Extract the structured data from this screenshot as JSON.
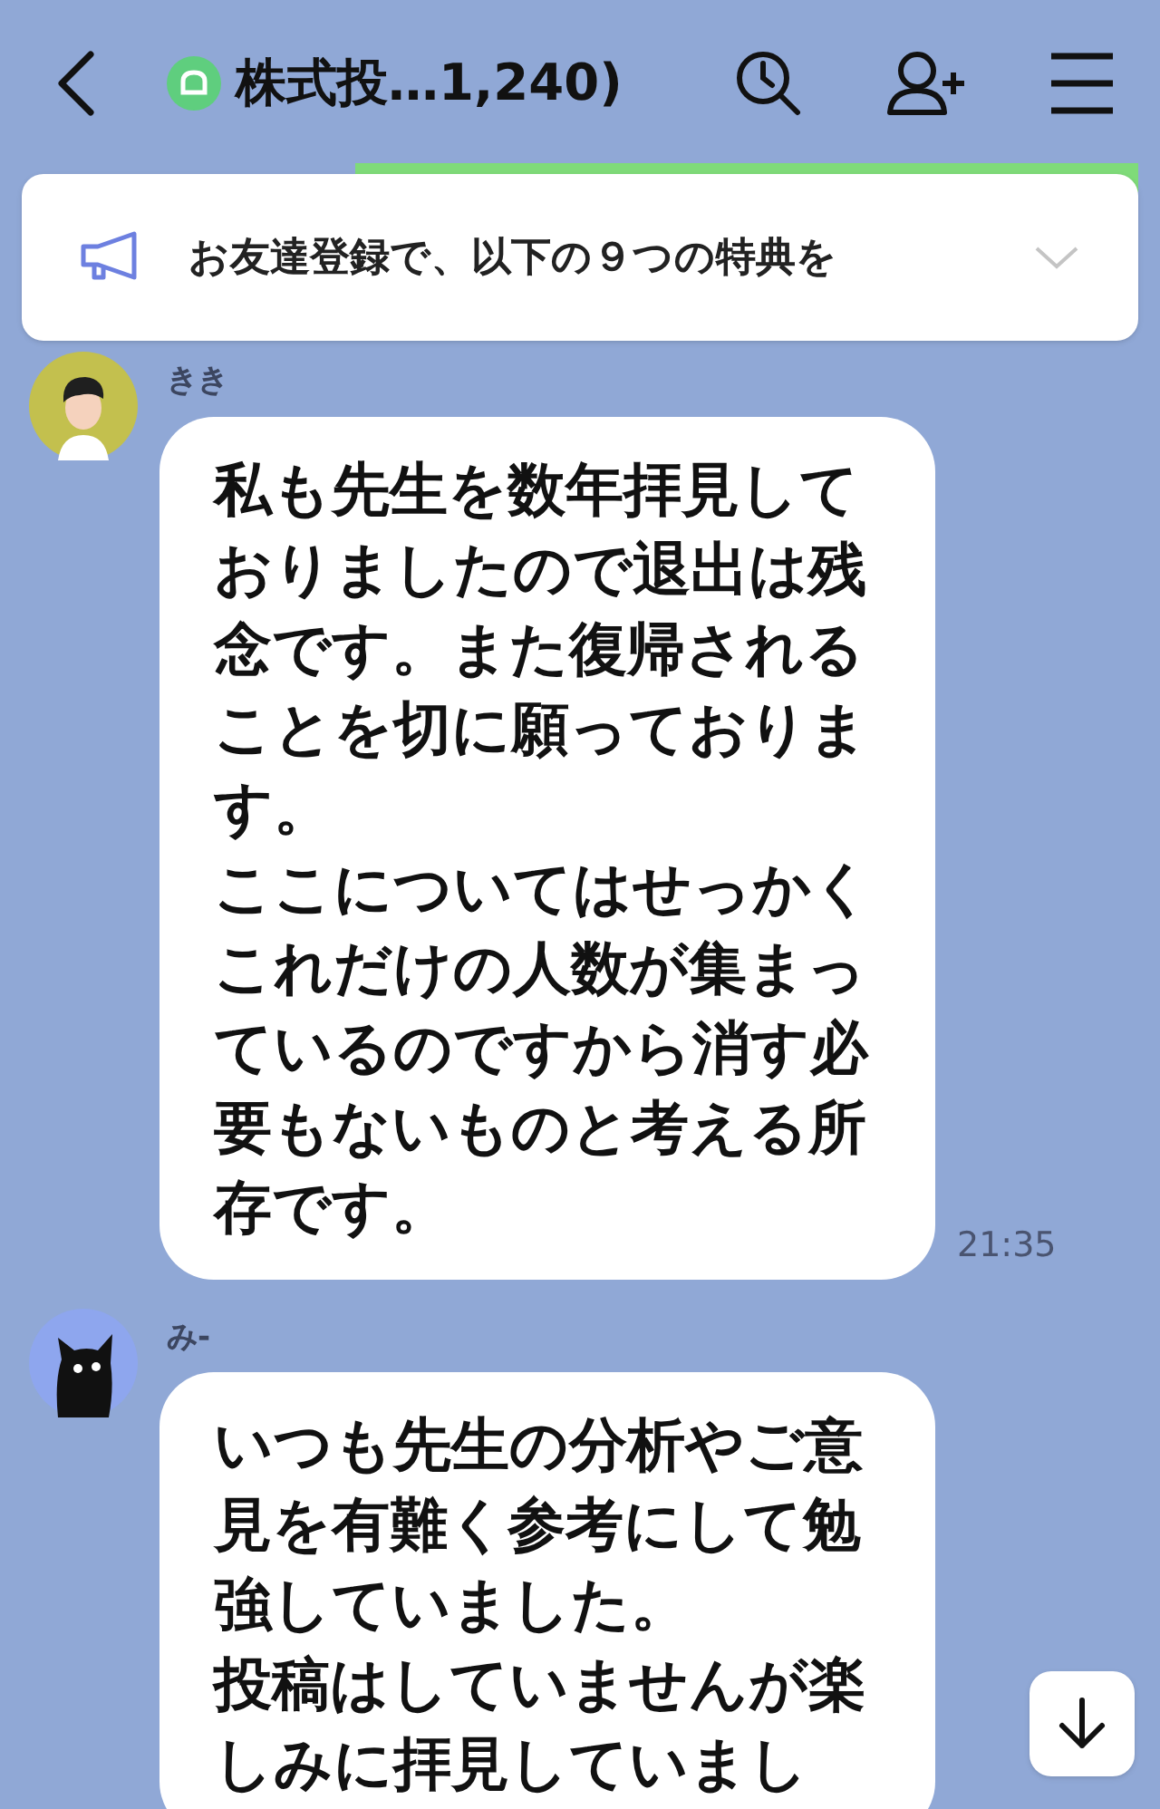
{
  "header": {
    "title": "株式投…1,240)"
  },
  "announcement": {
    "text": "お友達登録で、以下の９つの特典を",
    "expanded": false
  },
  "messages": [
    {
      "kind": "person",
      "sender": "きき",
      "paragraphs": [
        "私も先生を数年拝見しておりましたので退出は残念です。また復帰されることを切に願っております。",
        "ここについてはせっかくこれだけの人数が集まっているのですから消す必要もないものと考える所存です。"
      ],
      "time": "21:35"
    },
    {
      "kind": "cat",
      "sender": "み-",
      "paragraphs": [
        "いつも先生の分析やご意見を有難く参考にして勉強していました。",
        "投稿はしていませんが楽しみに拝見していまし"
      ]
    }
  ]
}
